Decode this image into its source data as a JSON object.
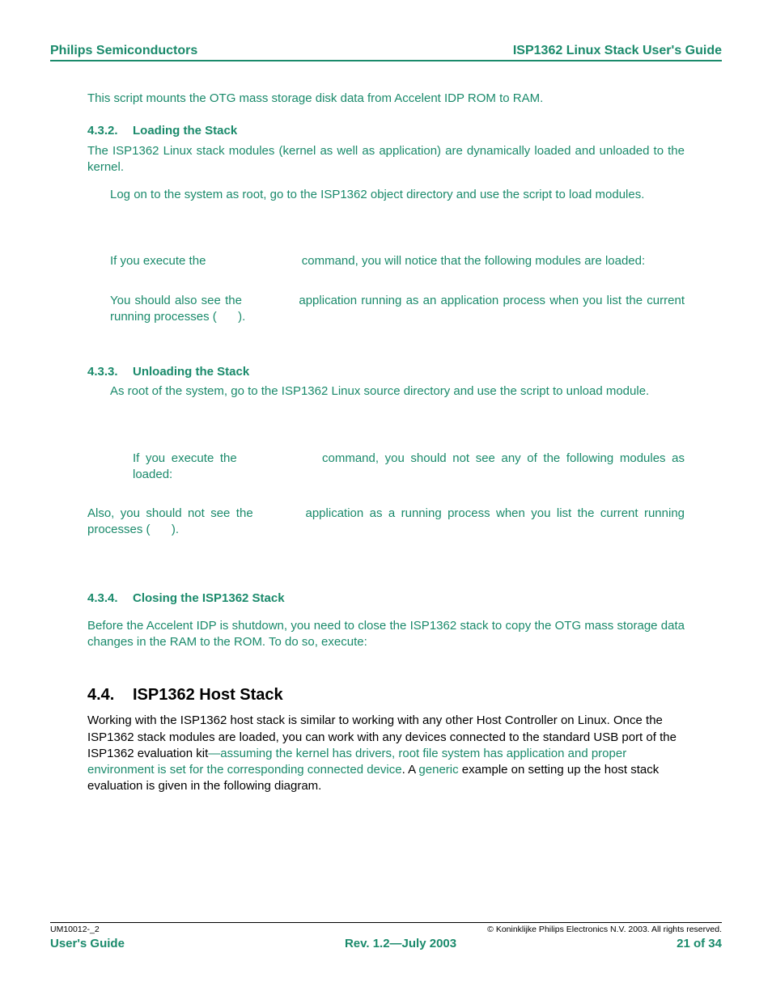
{
  "header": {
    "left": "Philips Semiconductors",
    "right": "ISP1362 Linux Stack User's Guide"
  },
  "body": {
    "intro": "This script mounts the OTG mass storage disk data from Accelent IDP ROM to RAM.",
    "s432": {
      "num": "4.3.2.",
      "title": "Loading the Stack",
      "p1": "The ISP1362 Linux stack modules (kernel as well as application) are dynamically loaded and unloaded to the kernel.",
      "p2": "Log on to the system as root, go to the ISP1362 object directory and use the script to load modules.",
      "p3a": "If you execute the ",
      "p3b": " command, you will notice that the following modules are loaded:",
      "p4a": "You should also see the ",
      "p4b": " application running as an application process when you list the current running processes (",
      "p4c": ")."
    },
    "s433": {
      "num": "4.3.3.",
      "title": "Unloading the Stack",
      "p1": "As root of the system, go to the ISP1362 Linux source directory and use the script to unload module.",
      "p2a": "If you execute the ",
      "p2b": " command, you should not see any of the following modules as loaded:",
      "p3a": "Also, you should not see the ",
      "p3b": " application as a running process when you list the current running processes (",
      "p3c": ")."
    },
    "s434": {
      "num": "4.3.4.",
      "title": "Closing the ISP1362 Stack",
      "p1": "Before the Accelent IDP is shutdown, you need to close the ISP1362 stack to copy the OTG mass storage data changes in the RAM to the ROM. To do so, execute:"
    },
    "s44": {
      "num": "4.4.",
      "title": "ISP1362 Host Stack",
      "p1a": "Working with the ISP1362 host stack is similar to working with any other Host Controller on Linux. Once the ISP1362 stack modules are loaded, you can work with any devices connected to the standard USB port of the ISP1362 evaluation kit",
      "p1b": "—assuming the kernel has drivers, root file system has application and proper environment is set for the corresponding connected device",
      "p1c": ". A ",
      "p1d": "generic",
      "p1e": " example on setting up the host stack evaluation is given in the following diagram."
    }
  },
  "footer": {
    "doc_id": "UM10012-_2",
    "copyright": "© Koninklijke Philips Electronics N.V. 2003. All rights reserved.",
    "left": "User's Guide",
    "center": "Rev. 1.2—July 2003",
    "right": "21 of 34"
  }
}
